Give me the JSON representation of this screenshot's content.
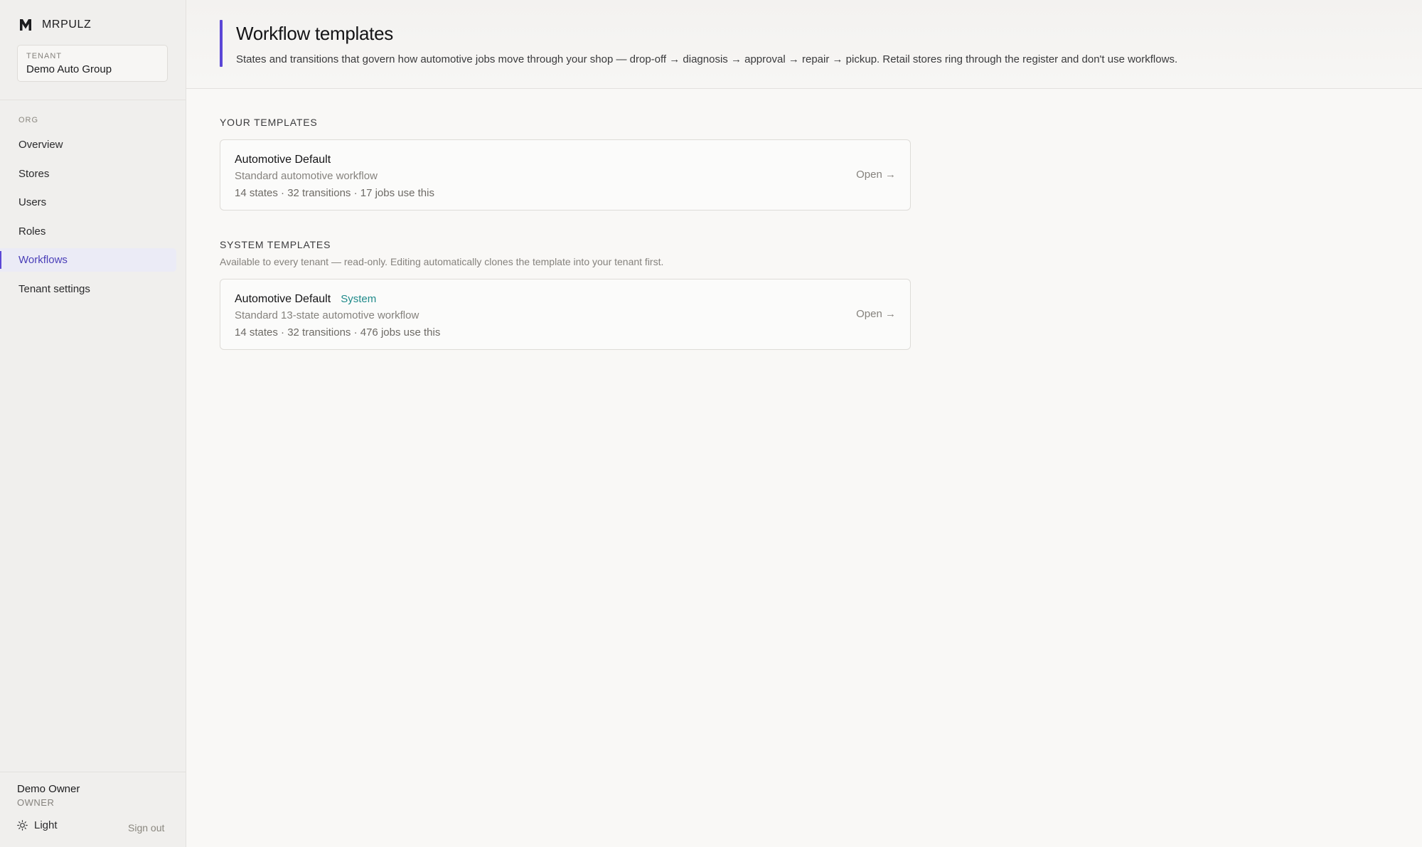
{
  "sidebar": {
    "brand": "MRPULZ",
    "tenant": {
      "label": "TENANT",
      "name": "Demo Auto Group"
    },
    "section_label": "ORG",
    "items": [
      {
        "label": "Overview"
      },
      {
        "label": "Stores"
      },
      {
        "label": "Users"
      },
      {
        "label": "Roles"
      },
      {
        "label": "Workflows",
        "active": true
      },
      {
        "label": "Tenant settings"
      }
    ],
    "user": {
      "name": "Demo Owner",
      "role": "OWNER"
    },
    "theme_label": "Light",
    "sign_out": "Sign out"
  },
  "header": {
    "title": "Workflow templates",
    "description": "States and transitions that govern how automotive jobs move through your shop — drop-off → diagnosis → approval → repair → pickup. Retail stores ring through the register and don't use workflows."
  },
  "your_templates": {
    "title": "YOUR TEMPLATES",
    "cards": [
      {
        "name": "Automotive Default",
        "description": "Standard automotive workflow",
        "meta": "14 states · 32 transitions · 17 jobs use this",
        "open": "Open →"
      }
    ]
  },
  "system_templates": {
    "title": "SYSTEM TEMPLATES",
    "subtitle": "Available to every tenant — read-only. Editing automatically clones the template into your tenant first.",
    "cards": [
      {
        "name": "Automotive Default",
        "badge": "System",
        "description": "Standard 13-state automotive workflow",
        "meta": "14 states · 32 transitions · 476 jobs use this",
        "open": "Open →"
      }
    ]
  },
  "colors": {
    "accent": "#5b47d6",
    "badge": "#1f8a8a"
  }
}
